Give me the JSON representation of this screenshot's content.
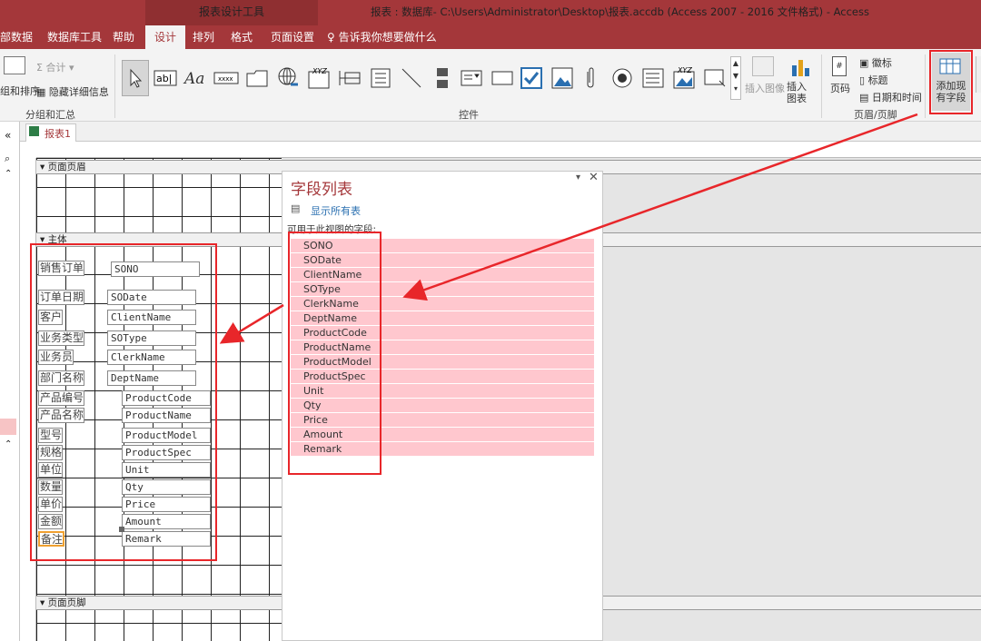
{
  "title_bar": {
    "context_tools": "报表设计工具",
    "window_title": "报表 : 数据库- C:\\Users\\Administrator\\Desktop\\报表.accdb (Access 2007 - 2016 文件格式)  -  Access"
  },
  "tabs": [
    "部数据",
    "数据库工具",
    "帮助",
    "设计",
    "排列",
    "格式",
    "页面设置"
  ],
  "active_tab": "设计",
  "tell_me": "告诉我你想要做什么",
  "ribbon": {
    "grouping": {
      "label": "分组和汇总",
      "sort_label": "组和排序",
      "total_label": "合计",
      "hide_details_label": "隐藏详细信息"
    },
    "controls": {
      "label": "控件",
      "insert_image_label": "插入图像",
      "insert_chart_label": "插入图表"
    },
    "header_footer": {
      "label": "页眉/页脚",
      "page_number_label": "页码",
      "logo_label": "徽标",
      "title_label": "标题",
      "datetime_label": "日期和时间"
    },
    "tools": {
      "add_fields_label": "添加现有字段"
    }
  },
  "document_tab": "报表1",
  "sections": {
    "page_header": "页面页眉",
    "detail": "主体",
    "page_footer": "页面页脚"
  },
  "report_labels": [
    "销售订单",
    "订单日期",
    "客户",
    "业务类型",
    "业务员",
    "部门名称",
    "产品编号",
    "产品名称",
    "型号",
    "规格",
    "单位",
    "数量",
    "单价",
    "金额",
    "备注"
  ],
  "report_fields": [
    "SONO",
    "SODate",
    "ClientName",
    "SOType",
    "ClerkName",
    "DeptName",
    "ProductCode",
    "ProductName",
    "ProductModel",
    "ProductSpec",
    "Unit",
    "Qty",
    "Price",
    "Amount",
    "Remark"
  ],
  "field_list": {
    "title": "字段列表",
    "show_all": "显示所有表",
    "available_label": "可用于此视图的字段:",
    "fields": [
      "SONO",
      "SODate",
      "ClientName",
      "SOType",
      "ClerkName",
      "DeptName",
      "ProductCode",
      "ProductName",
      "ProductModel",
      "ProductSpec",
      "Unit",
      "Qty",
      "Price",
      "Amount",
      "Remark"
    ]
  },
  "colors": {
    "brand": "#a4373a",
    "annotation": "#e8262a",
    "field_highlight": "#ffc7ce"
  }
}
